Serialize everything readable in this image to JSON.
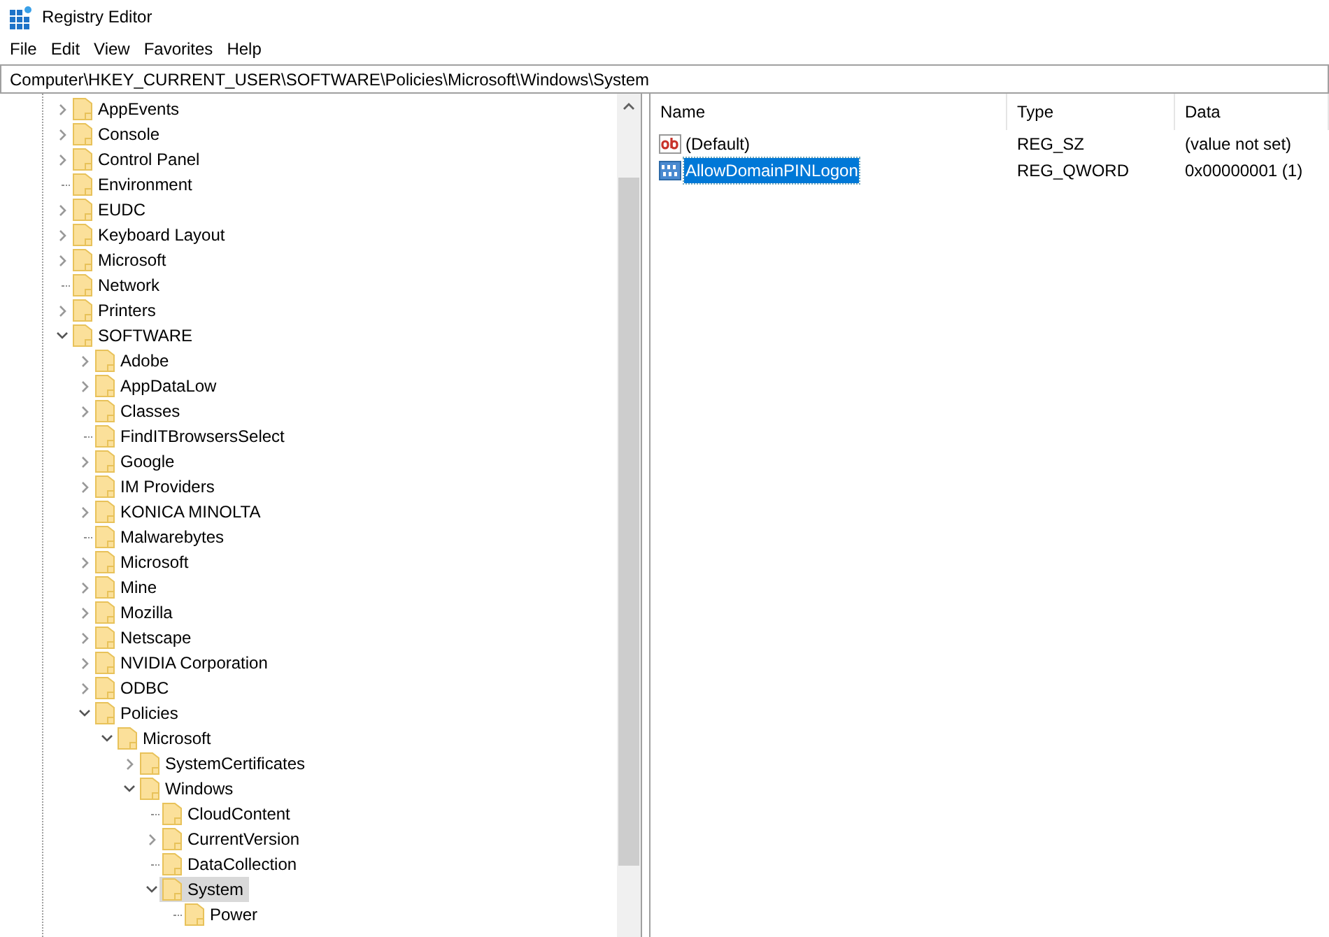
{
  "window": {
    "title": "Registry Editor"
  },
  "menu": [
    "File",
    "Edit",
    "View",
    "Favorites",
    "Help"
  ],
  "address": "Computer\\HKEY_CURRENT_USER\\SOFTWARE\\Policies\\Microsoft\\Windows\\System",
  "tree": [
    {
      "label": "AppEvents",
      "kind": "branch",
      "expanded": false,
      "selected": false
    },
    {
      "label": "Console",
      "kind": "branch",
      "expanded": false,
      "selected": false
    },
    {
      "label": "Control Panel",
      "kind": "branch",
      "expanded": false,
      "selected": false
    },
    {
      "label": "Environment",
      "kind": "leaf",
      "selected": false
    },
    {
      "label": "EUDC",
      "kind": "branch",
      "expanded": false,
      "selected": false
    },
    {
      "label": "Keyboard Layout",
      "kind": "branch",
      "expanded": false,
      "selected": false
    },
    {
      "label": "Microsoft",
      "kind": "branch",
      "expanded": false,
      "selected": false
    },
    {
      "label": "Network",
      "kind": "leaf",
      "selected": false
    },
    {
      "label": "Printers",
      "kind": "branch",
      "expanded": false,
      "selected": false
    },
    {
      "label": "SOFTWARE",
      "kind": "branch",
      "expanded": true,
      "selected": false,
      "children": [
        {
          "label": "Adobe",
          "kind": "branch",
          "expanded": false,
          "selected": false
        },
        {
          "label": "AppDataLow",
          "kind": "branch",
          "expanded": false,
          "selected": false
        },
        {
          "label": "Classes",
          "kind": "branch",
          "expanded": false,
          "selected": false
        },
        {
          "label": "FindITBrowsersSelect",
          "kind": "leaf",
          "selected": false
        },
        {
          "label": "Google",
          "kind": "branch",
          "expanded": false,
          "selected": false
        },
        {
          "label": "IM Providers",
          "kind": "branch",
          "expanded": false,
          "selected": false
        },
        {
          "label": "KONICA MINOLTA",
          "kind": "branch",
          "expanded": false,
          "selected": false
        },
        {
          "label": "Malwarebytes",
          "kind": "leaf",
          "selected": false
        },
        {
          "label": "Microsoft",
          "kind": "branch",
          "expanded": false,
          "selected": false
        },
        {
          "label": "Mine",
          "kind": "branch",
          "expanded": false,
          "selected": false
        },
        {
          "label": "Mozilla",
          "kind": "branch",
          "expanded": false,
          "selected": false
        },
        {
          "label": "Netscape",
          "kind": "branch",
          "expanded": false,
          "selected": false
        },
        {
          "label": "NVIDIA Corporation",
          "kind": "branch",
          "expanded": false,
          "selected": false
        },
        {
          "label": "ODBC",
          "kind": "branch",
          "expanded": false,
          "selected": false
        },
        {
          "label": "Policies",
          "kind": "branch",
          "expanded": true,
          "selected": false,
          "children": [
            {
              "label": "Microsoft",
              "kind": "branch",
              "expanded": true,
              "selected": false,
              "children": [
                {
                  "label": "SystemCertificates",
                  "kind": "branch",
                  "expanded": false,
                  "selected": false
                },
                {
                  "label": "Windows",
                  "kind": "branch",
                  "expanded": true,
                  "selected": false,
                  "children": [
                    {
                      "label": "CloudContent",
                      "kind": "leaf",
                      "selected": false
                    },
                    {
                      "label": "CurrentVersion",
                      "kind": "branch",
                      "expanded": false,
                      "selected": false
                    },
                    {
                      "label": "DataCollection",
                      "kind": "leaf",
                      "selected": false
                    },
                    {
                      "label": "System",
                      "kind": "branch",
                      "expanded": true,
                      "selected": true,
                      "children": [
                        {
                          "label": "Power",
                          "kind": "leaf",
                          "selected": false
                        }
                      ]
                    }
                  ]
                }
              ]
            }
          ]
        }
      ]
    }
  ],
  "columns": [
    "Name",
    "Type",
    "Data"
  ],
  "values": [
    {
      "kind": "string",
      "name": "(Default)",
      "type": "REG_SZ",
      "data": "(value not set)",
      "selected": false
    },
    {
      "kind": "binary",
      "name": "AllowDomainPINLogon",
      "type": "REG_QWORD",
      "data": "0x00000001 (1)",
      "selected": true
    }
  ]
}
